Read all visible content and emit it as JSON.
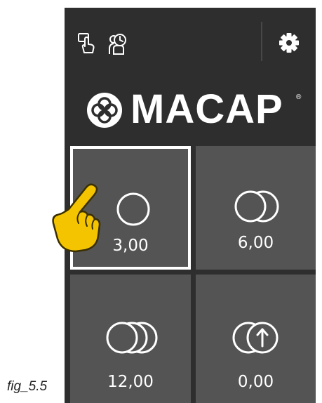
{
  "brand": {
    "name": "MACAP",
    "registered_mark": "®"
  },
  "top_icons": [
    "touch-hand-icon",
    "user-clock-icon"
  ],
  "settings_icon": "gear-icon",
  "tiles": [
    {
      "label": "3,00",
      "icon": "single-circle-icon",
      "selected": true
    },
    {
      "label": "6,00",
      "icon": "double-circle-icon",
      "selected": false
    },
    {
      "label": "12,00",
      "icon": "triple-circle-icon",
      "selected": false
    },
    {
      "label": "0,00",
      "icon": "circle-arrow-icon",
      "selected": false
    }
  ],
  "figure_caption": "fig_5.5",
  "colors": {
    "panel": "#2e2e2e",
    "tile": "#545454",
    "selection": "#ffffff",
    "pointer_hand": "#f5c400"
  }
}
